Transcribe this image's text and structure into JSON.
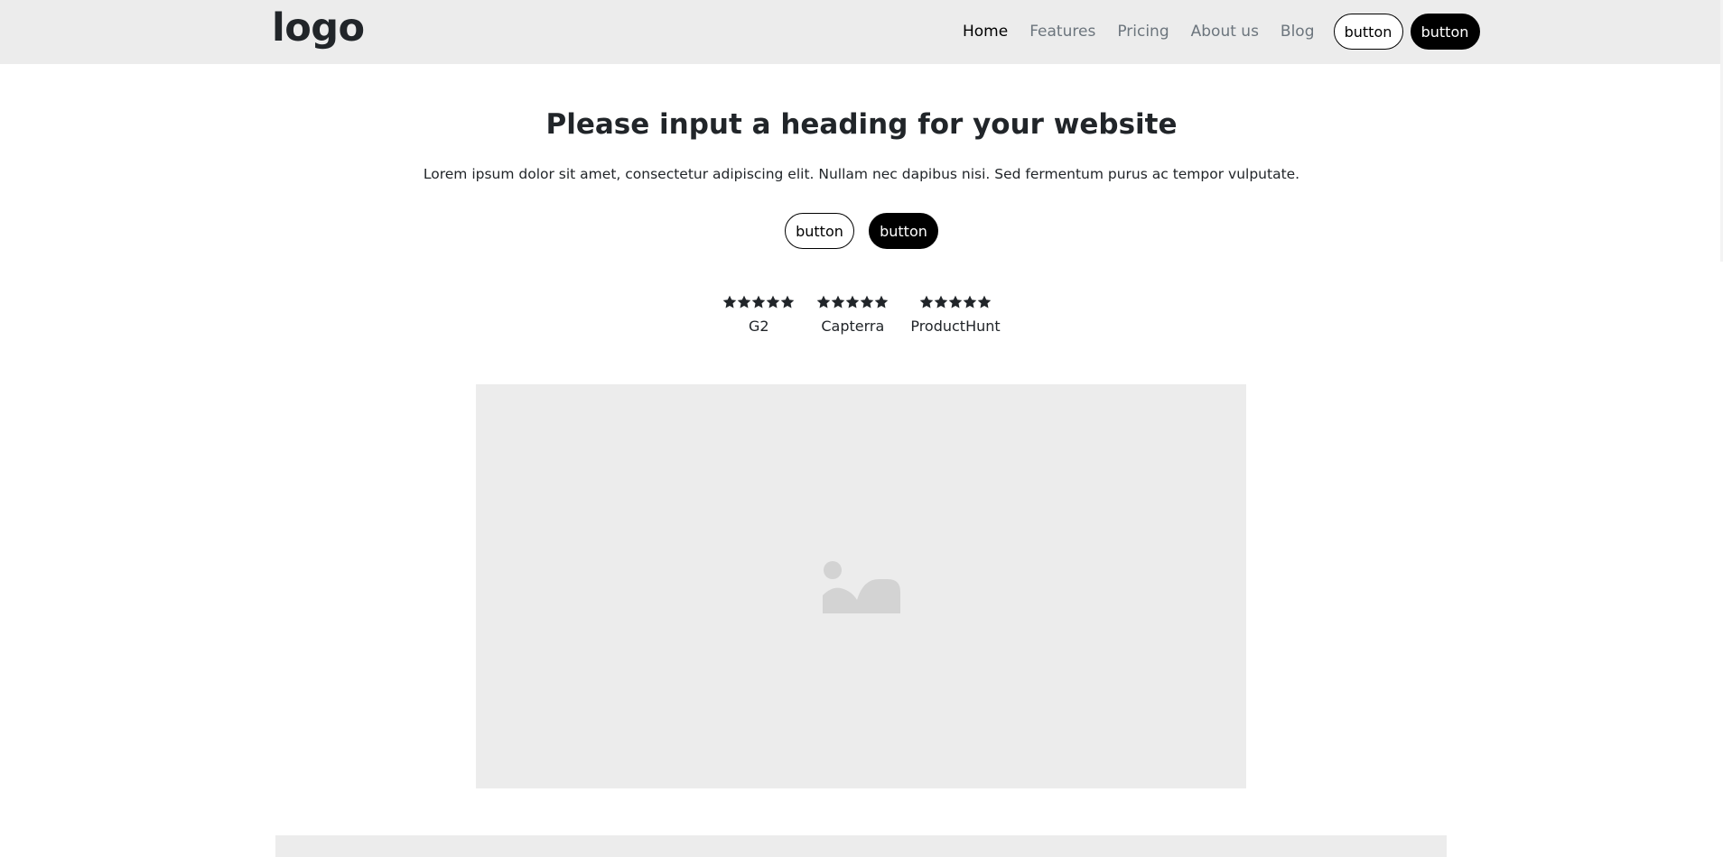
{
  "header": {
    "logo": "logo",
    "nav": [
      {
        "label": "Home",
        "active": true
      },
      {
        "label": "Features",
        "active": false
      },
      {
        "label": "Pricing",
        "active": false
      },
      {
        "label": "About us",
        "active": false
      },
      {
        "label": "Blog",
        "active": false
      }
    ],
    "button_outline_label": "button",
    "button_dark_label": "button"
  },
  "hero": {
    "title": "Please input a heading for your website",
    "text": "Lorem ipsum dolor sit amet, consectetur adipiscing elit. Nullam nec dapibus nisi. Sed fermentum purus ac tempor vulputate.",
    "button_outline_label": "button",
    "button_dark_label": "button"
  },
  "ratings": [
    {
      "source": "G2",
      "stars": 5
    },
    {
      "source": "Capterra",
      "stars": 5
    },
    {
      "source": "ProductHunt",
      "stars": 5
    }
  ],
  "media": {
    "icon": "image-placeholder-icon"
  },
  "colors": {
    "nav_background": "#ececec",
    "text": "#212529",
    "muted_link": "#6c757d",
    "button_dark": "#000000",
    "star": "#212529",
    "placeholder_icon": "#d3d3d3"
  }
}
